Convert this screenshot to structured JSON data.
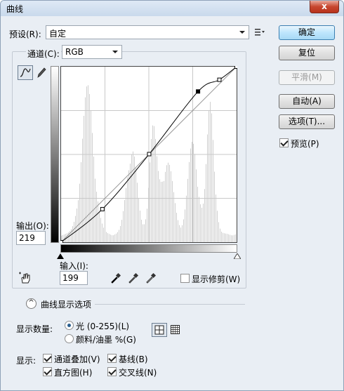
{
  "window": {
    "title": "曲线",
    "close_label": "x"
  },
  "preset": {
    "label": "预设(R):",
    "value": "自定",
    "menu_icon": "preset-options-icon"
  },
  "channel": {
    "label": "通道(C):",
    "value": "RGB"
  },
  "buttons": {
    "ok": "确定",
    "reset": "复位",
    "smooth": "平滑(M)",
    "auto": "自动(A)",
    "options": "选项(T)..."
  },
  "preview": {
    "label": "预览(P)",
    "checked": true
  },
  "output": {
    "label": "输出(O):",
    "value": "219"
  },
  "input": {
    "label": "输入(I):",
    "value": "199"
  },
  "show_clipping": {
    "label": "显示修剪(W)",
    "checked": false
  },
  "curve_display_options": {
    "label": "曲线显示选项"
  },
  "show_amount": {
    "label": "显示数量:",
    "light": "光 (0-255)(L)",
    "pigment": "颜料/油墨 %(G)",
    "selected": "light"
  },
  "show": {
    "label": "显示:",
    "channel_overlays": "通道叠加(V)",
    "baseline": "基线(B)",
    "histogram": "直方图(H)",
    "intersection": "交叉线(N)"
  },
  "curve": {
    "points": [
      [
        0,
        0
      ],
      [
        60,
        48
      ],
      [
        128,
        128
      ],
      [
        199,
        219
      ],
      [
        230,
        236
      ],
      [
        255,
        255
      ]
    ],
    "selected_point": [
      199,
      219
    ]
  },
  "colors": {
    "accent": "#3c7fb1",
    "graph_bg": "#ffffff",
    "grid": "#c8c8c8",
    "histogram": "#cfcfcf"
  }
}
